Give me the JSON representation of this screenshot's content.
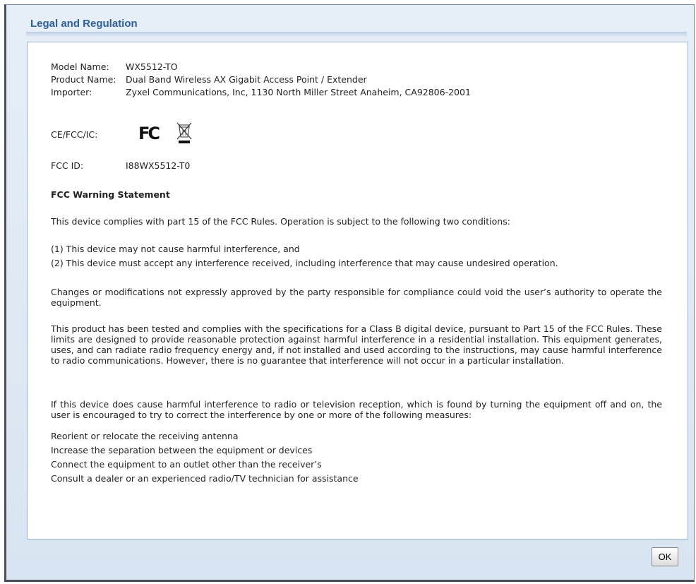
{
  "dialog": {
    "title": "Legal and Regulation",
    "ok_label": "OK"
  },
  "info": {
    "model_label": "Model Name:",
    "model_value": "WX5512-TO",
    "product_label": "Product Name:",
    "product_value": "Dual Band Wireless AX Gigabit Access Point / Extender",
    "importer_label": "Importer:",
    "importer_value": "Zyxel Communications, Inc, 1130 North Miller Street Anaheim, CA92806-2001",
    "cert_label": "CE/FCC/IC:",
    "fcc_logo": "FC",
    "fccid_label": "FCC ID:",
    "fccid_value": "I88WX5512-T0"
  },
  "statement": {
    "heading": "FCC Warning Statement",
    "intro": "This device complies with part 15 of the FCC Rules. Operation is subject to the following two conditions:",
    "cond1": "(1) This device may not cause harmful interference, and",
    "cond2": "(2) This device must accept any interference received, including interference that may cause undesired operation.",
    "changes": "Changes or modifications not expressly approved by the party responsible for compliance could void the user’s authority to operate the equipment.",
    "tested": "This product has been tested and complies with the specifications for a Class B digital device, pursuant to Part 15 of the FCC Rules. These limits are designed to provide reasonable protection against harmful interference in a residential installation. This equipment generates, uses, and can radiate radio frequency energy and, if not installed and used according to the instructions, may cause harmful interference to radio communications. However, there is no guarantee that interference will not occur in a particular installation.",
    "if_device": "If this device does cause harmful interference to radio or television reception, which is found by turning the equipment off and on, the user is encouraged to try to correct the interference by one or more of the following measures:",
    "measures": [
      "Reorient or relocate the receiving antenna",
      "Increase the separation between the equipment or devices",
      "Connect the equipment to an outlet other than the receiver’s",
      "Consult a dealer or an experienced radio/TV technician for assistance"
    ]
  },
  "icons": {
    "fcc": "fcc-logo-icon",
    "weee": "weee-bin-icon"
  }
}
